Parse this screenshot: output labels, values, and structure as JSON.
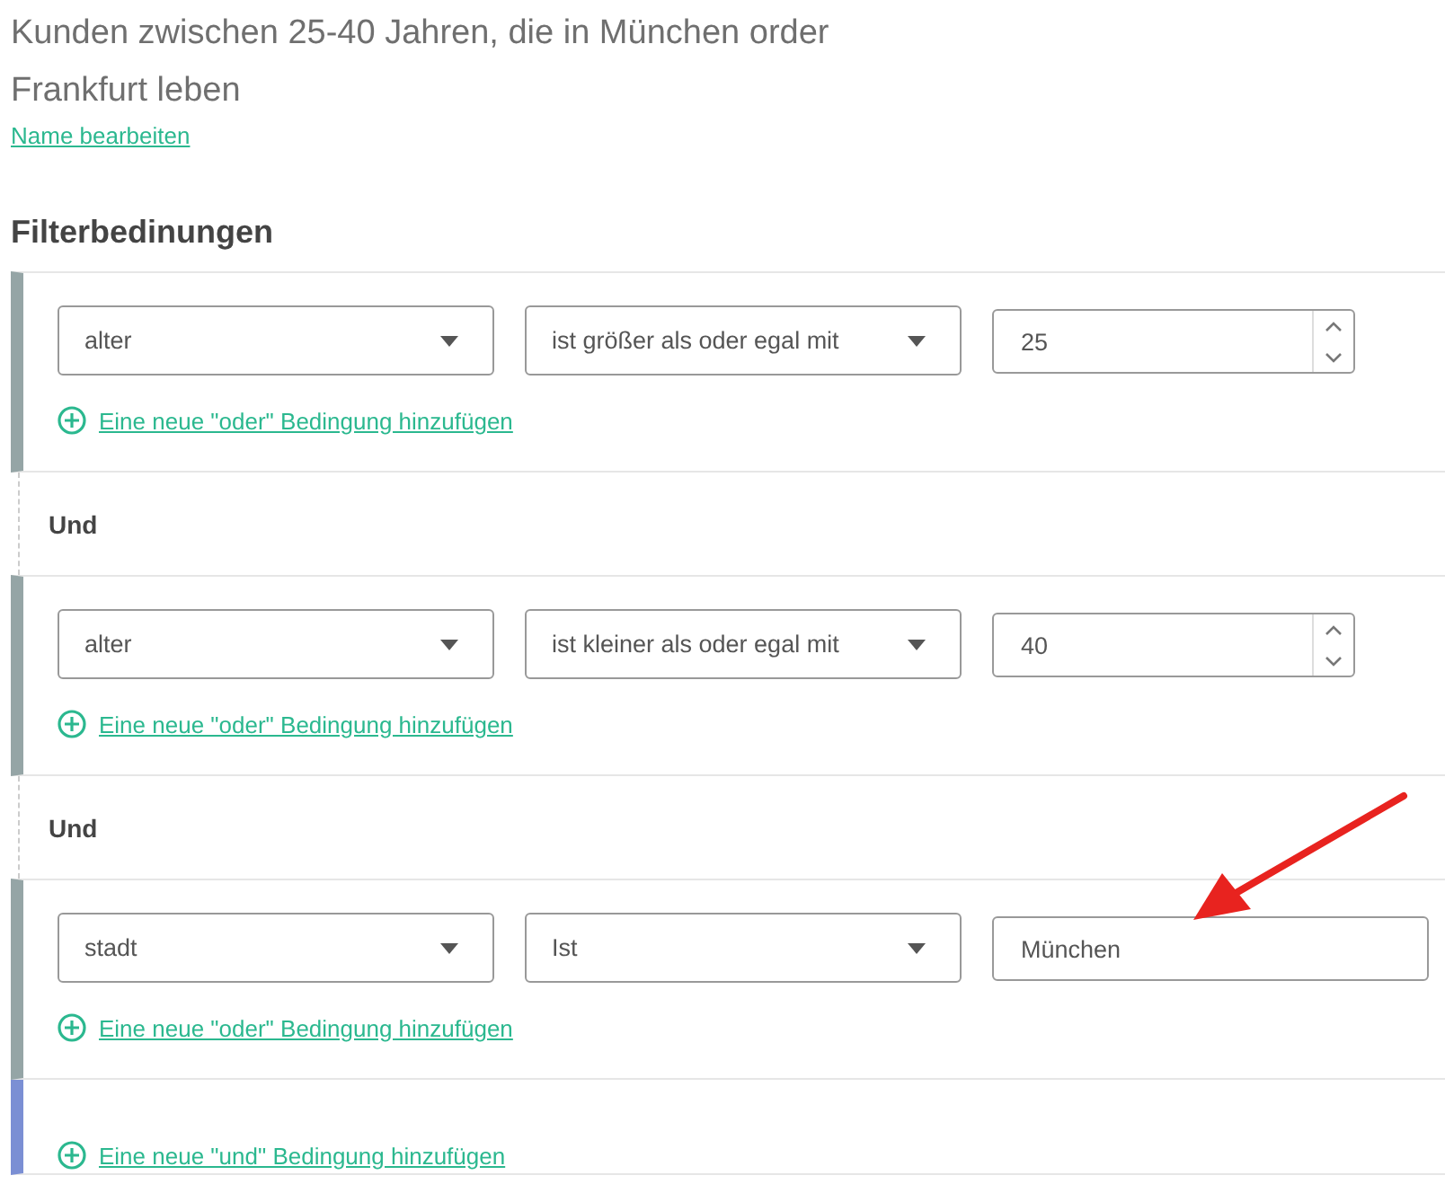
{
  "title": "Kunden zwischen 25-40 Jahren, die in München order Frankfurt leben",
  "edit_link": "Name bearbeiten",
  "section_title": "Filterbedinungen",
  "groups": [
    {
      "field": "alter",
      "operator": "ist größer als oder egal mit",
      "value": "25",
      "kind": "number",
      "add_or": "Eine neue \"oder\" Bedingung hinzufügen"
    },
    {
      "field": "alter",
      "operator": "ist kleiner als oder egal mit",
      "value": "40",
      "kind": "number",
      "add_or": "Eine neue \"oder\" Bedingung hinzufügen"
    },
    {
      "field": "stadt",
      "operator": "Ist",
      "value": "München",
      "kind": "text",
      "add_or": "Eine neue \"oder\" Bedingung hinzufügen"
    }
  ],
  "connectors": [
    "Und",
    "Und"
  ],
  "add_and": "Eine neue \"und\" Bedingung hinzufügen"
}
